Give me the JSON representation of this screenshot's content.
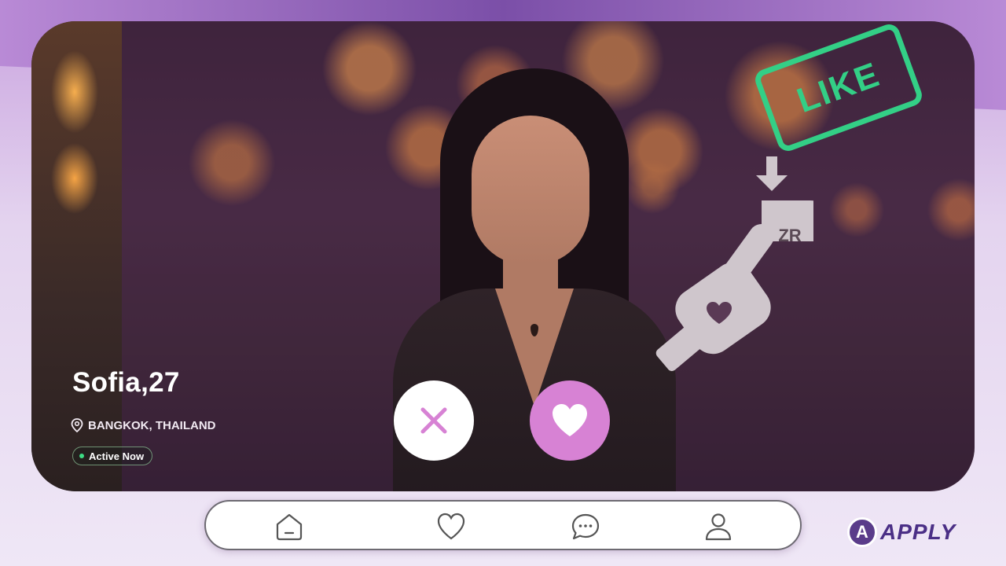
{
  "profile": {
    "name_age": "Sofia,27",
    "location": "BANGKOK, THAILAND",
    "status": "Active Now"
  },
  "swipe_overlay": {
    "stamp_label": "LIKE",
    "key_hint": "ZR"
  },
  "actions": {
    "dislike_icon": "close-icon",
    "like_icon": "heart-icon"
  },
  "bottom_nav": {
    "items": [
      {
        "icon": "home-icon"
      },
      {
        "icon": "heart-icon"
      },
      {
        "icon": "chat-icon"
      },
      {
        "icon": "profile-icon"
      }
    ]
  },
  "brand": {
    "mark": "A",
    "name": "APPLY"
  },
  "colors": {
    "like_green": "#33cf86",
    "like_pink": "#d782d4",
    "dislike_x": "#d782d4",
    "brand_purple": "#4b2f86"
  }
}
